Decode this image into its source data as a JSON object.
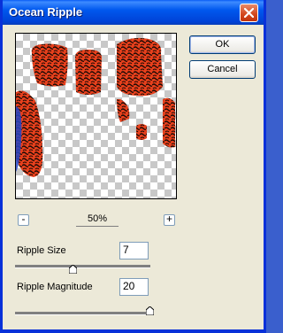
{
  "dialog": {
    "title": "Ocean Ripple"
  },
  "buttons": {
    "ok_label": "OK",
    "cancel_label": "Cancel"
  },
  "zoom": {
    "out_label": "-",
    "level": "50%",
    "in_label": "+"
  },
  "controls": {
    "ripple_size_label": "Ripple Size",
    "ripple_size_value": "7",
    "ripple_size_fraction": 0.43,
    "ripple_magnitude_label": "Ripple Magnitude",
    "ripple_magnitude_value": "20",
    "ripple_magnitude_fraction": 1.0
  },
  "colors": {
    "title_bar": "#0054e3",
    "window_bg": "#ece9d8",
    "preview_fill": "#e8401c"
  }
}
